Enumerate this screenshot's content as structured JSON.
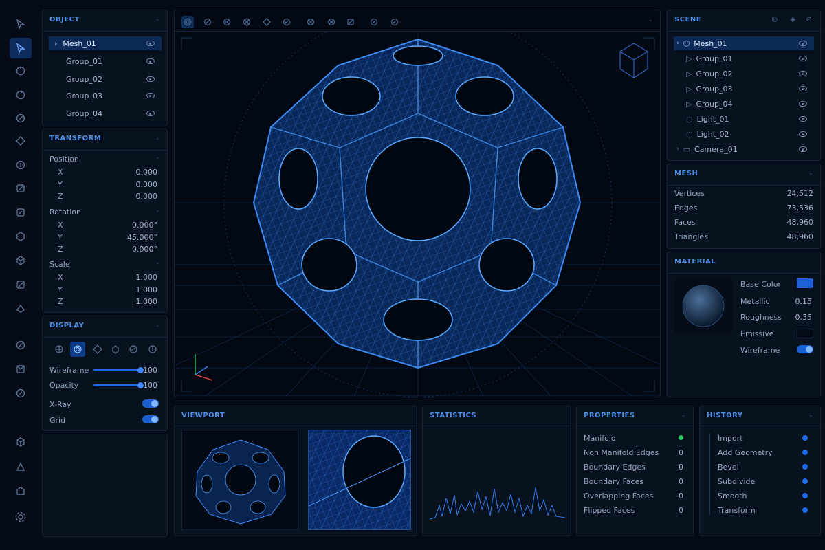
{
  "object": {
    "title": "OBJECT",
    "items": [
      "Mesh_01",
      "Group_01",
      "Group_02",
      "Group_03",
      "Group_04"
    ]
  },
  "transform": {
    "title": "TRANSFORM",
    "position_label": "Position",
    "rotation_label": "Rotation",
    "scale_label": "Scale",
    "axes": [
      "X",
      "Y",
      "Z"
    ],
    "position": [
      "0.000",
      "0.000",
      "0.000"
    ],
    "rotation": [
      "0.000°",
      "45.000°",
      "0.000°"
    ],
    "scale": [
      "1.000",
      "1.000",
      "1.000"
    ]
  },
  "display": {
    "title": "DISPLAY",
    "wireframe_label": "Wireframe",
    "wireframe_value": "100",
    "opacity_label": "Opacity",
    "opacity_value": "100",
    "xray_label": "X-Ray",
    "grid_label": "Grid"
  },
  "scene": {
    "title": "SCENE",
    "items": [
      "Mesh_01",
      "Group_01",
      "Group_02",
      "Group_03",
      "Group_04",
      "Light_01",
      "Light_02",
      "Camera_01"
    ]
  },
  "mesh": {
    "title": "MESH",
    "rows": [
      {
        "label": "Vertices",
        "value": "24,512"
      },
      {
        "label": "Edges",
        "value": "73,536"
      },
      {
        "label": "Faces",
        "value": "48,960"
      },
      {
        "label": "Triangles",
        "value": "48,960"
      }
    ]
  },
  "material": {
    "title": "MATERIAL",
    "base_color_label": "Base Color",
    "base_color": "#1d5fd6",
    "metallic_label": "Metallic",
    "metallic_value": "0.15",
    "roughness_label": "Roughness",
    "roughness_value": "0.35",
    "emissive_label": "Emissive",
    "wireframe_label": "Wireframe"
  },
  "viewport_panel": {
    "title": "VIEWPORT"
  },
  "statistics": {
    "title": "STATISTICS"
  },
  "properties": {
    "title": "PROPERTIES",
    "rows": [
      {
        "label": "Manifold",
        "value": ""
      },
      {
        "label": "Non Manifold Edges",
        "value": "0"
      },
      {
        "label": "Boundary Edges",
        "value": "0"
      },
      {
        "label": "Boundary Faces",
        "value": "0"
      },
      {
        "label": "Overlapping Faces",
        "value": "0"
      },
      {
        "label": "Flipped Faces",
        "value": "0"
      }
    ]
  },
  "history": {
    "title": "HISTORY",
    "items": [
      "Import",
      "Add Geometry",
      "Bevel",
      "Subdivide",
      "Smooth",
      "Transform"
    ]
  },
  "colors": {
    "accent": "#1c6cf0",
    "ok": "#22c55e",
    "background": "#050b17"
  }
}
